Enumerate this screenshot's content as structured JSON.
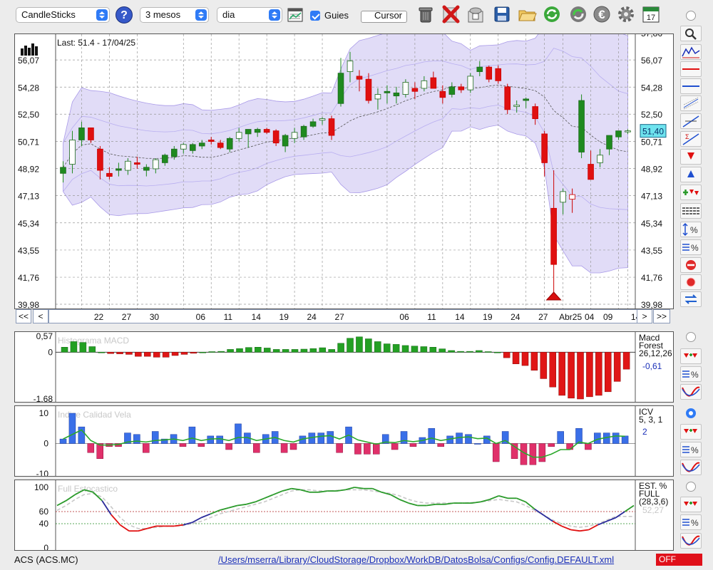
{
  "toolbar": {
    "chart_type": "CandleSticks",
    "period": "3 mesos",
    "interval": "dia",
    "guies_label": "Guies",
    "guies_checked": true,
    "cursor_label": "Cursor",
    "cursor_checked": false,
    "help_label": "?",
    "icons": [
      "calendar-grid-icon",
      "trash-icon",
      "delete-x-icon",
      "db-icon",
      "save-icon",
      "folder-icon",
      "refresh-icon",
      "sync-icon",
      "euro-icon",
      "gear-icon",
      "calendar-icon"
    ],
    "calendar_day": "17"
  },
  "main_chart": {
    "last_label": "Last: 51.4 - 17/04/25",
    "last_value_badge": "51,40",
    "y_ticks": [
      "56,07",
      "54,28",
      "52,50",
      "50,71",
      "48,92",
      "47,13",
      "45,34",
      "43,55",
      "41,76",
      "39,98"
    ],
    "y_top_partial": "57,86",
    "x_labels": [
      "22",
      "27",
      "30",
      "06",
      "11",
      "14",
      "19",
      "24",
      "27",
      "06",
      "11",
      "14",
      "19",
      "24",
      "27",
      "Abr25",
      "04",
      "09",
      "14",
      "17"
    ],
    "nav": {
      "first": "<<",
      "prev": "<",
      "next": ">",
      "last": ">>"
    }
  },
  "chart_data": [
    {
      "type": "candlestick",
      "title": "",
      "ylim": [
        39.98,
        57.86
      ],
      "candles": [
        {
          "o": 48.6,
          "h": 49.4,
          "l": 48.0,
          "c": 49.0
        },
        {
          "o": 49.2,
          "h": 51.4,
          "l": 48.6,
          "c": 50.8
        },
        {
          "o": 50.8,
          "h": 52.0,
          "l": 50.4,
          "c": 51.6
        },
        {
          "o": 51.6,
          "h": 51.6,
          "l": 50.6,
          "c": 50.8
        },
        {
          "o": 50.2,
          "h": 50.4,
          "l": 48.2,
          "c": 48.8
        },
        {
          "o": 48.6,
          "h": 49.0,
          "l": 48.2,
          "c": 48.4
        },
        {
          "o": 48.8,
          "h": 49.3,
          "l": 48.4,
          "c": 48.9
        },
        {
          "o": 48.8,
          "h": 49.6,
          "l": 48.5,
          "c": 49.4
        },
        {
          "o": 49.3,
          "h": 49.7,
          "l": 48.9,
          "c": 49.2
        },
        {
          "o": 48.8,
          "h": 49.2,
          "l": 48.4,
          "c": 49.0
        },
        {
          "o": 48.9,
          "h": 49.6,
          "l": 48.6,
          "c": 49.5
        },
        {
          "o": 49.3,
          "h": 49.9,
          "l": 49.1,
          "c": 49.8
        },
        {
          "o": 49.7,
          "h": 50.4,
          "l": 49.5,
          "c": 50.2
        },
        {
          "o": 50.2,
          "h": 50.6,
          "l": 49.9,
          "c": 50.5
        },
        {
          "o": 50.1,
          "h": 50.6,
          "l": 49.9,
          "c": 50.5
        },
        {
          "o": 50.4,
          "h": 50.8,
          "l": 50.2,
          "c": 50.6
        },
        {
          "o": 50.8,
          "h": 51.0,
          "l": 50.5,
          "c": 50.7
        },
        {
          "o": 50.6,
          "h": 50.8,
          "l": 50.2,
          "c": 50.3
        },
        {
          "o": 50.2,
          "h": 51.0,
          "l": 50.0,
          "c": 50.9
        },
        {
          "o": 50.9,
          "h": 51.6,
          "l": 50.7,
          "c": 51.3
        },
        {
          "o": 51.2,
          "h": 51.5,
          "l": 50.3,
          "c": 51.5
        },
        {
          "o": 51.3,
          "h": 51.6,
          "l": 51.0,
          "c": 51.5
        },
        {
          "o": 51.5,
          "h": 51.6,
          "l": 51.2,
          "c": 51.3
        },
        {
          "o": 51.4,
          "h": 51.5,
          "l": 50.4,
          "c": 50.6
        },
        {
          "o": 50.4,
          "h": 51.2,
          "l": 50.0,
          "c": 51.1
        },
        {
          "o": 50.9,
          "h": 51.6,
          "l": 50.6,
          "c": 51.3
        },
        {
          "o": 51.0,
          "h": 51.8,
          "l": 50.8,
          "c": 51.7
        },
        {
          "o": 51.7,
          "h": 52.2,
          "l": 51.6,
          "c": 52.0
        },
        {
          "o": 52.1,
          "h": 52.3,
          "l": 51.8,
          "c": 52.2
        },
        {
          "o": 52.2,
          "h": 52.4,
          "l": 50.8,
          "c": 51.1
        },
        {
          "o": 53.2,
          "h": 56.2,
          "l": 53.0,
          "c": 55.2
        },
        {
          "o": 55.3,
          "h": 56.6,
          "l": 54.6,
          "c": 56.0
        },
        {
          "o": 55.0,
          "h": 55.4,
          "l": 54.0,
          "c": 54.8
        },
        {
          "o": 54.8,
          "h": 55.2,
          "l": 53.2,
          "c": 53.4
        },
        {
          "o": 53.5,
          "h": 54.2,
          "l": 52.8,
          "c": 53.8
        },
        {
          "o": 53.9,
          "h": 54.4,
          "l": 53.2,
          "c": 54.0
        },
        {
          "o": 53.7,
          "h": 54.3,
          "l": 53.2,
          "c": 53.9
        },
        {
          "o": 53.8,
          "h": 54.8,
          "l": 53.6,
          "c": 54.6
        },
        {
          "o": 54.2,
          "h": 54.6,
          "l": 53.5,
          "c": 54.0
        },
        {
          "o": 54.2,
          "h": 55.0,
          "l": 54.0,
          "c": 54.7
        },
        {
          "o": 54.9,
          "h": 55.3,
          "l": 54.4,
          "c": 54.2
        },
        {
          "o": 54.0,
          "h": 54.4,
          "l": 53.2,
          "c": 53.6
        },
        {
          "o": 53.8,
          "h": 54.6,
          "l": 53.6,
          "c": 54.3
        },
        {
          "o": 54.3,
          "h": 54.5,
          "l": 53.9,
          "c": 54.1
        },
        {
          "o": 54.1,
          "h": 55.2,
          "l": 53.9,
          "c": 55.0
        },
        {
          "o": 55.3,
          "h": 56.0,
          "l": 55.0,
          "c": 55.6
        },
        {
          "o": 55.6,
          "h": 55.7,
          "l": 54.6,
          "c": 54.8
        },
        {
          "o": 55.5,
          "h": 55.7,
          "l": 54.5,
          "c": 54.7
        },
        {
          "o": 54.3,
          "h": 54.5,
          "l": 52.5,
          "c": 52.8
        },
        {
          "o": 53.0,
          "h": 53.4,
          "l": 52.6,
          "c": 53.1
        },
        {
          "o": 53.4,
          "h": 53.6,
          "l": 52.9,
          "c": 53.5
        },
        {
          "o": 53.0,
          "h": 53.2,
          "l": 51.8,
          "c": 52.2
        },
        {
          "o": 51.2,
          "h": 51.4,
          "l": 48.4,
          "c": 49.3
        },
        {
          "o": 46.3,
          "h": 48.8,
          "l": 40.7,
          "c": 42.6
        },
        {
          "o": 46.7,
          "h": 47.6,
          "l": 45.9,
          "c": 47.4
        },
        {
          "o": 47.2,
          "h": 47.6,
          "l": 46.0,
          "c": 46.9
        },
        {
          "o": 50.0,
          "h": 53.8,
          "l": 49.6,
          "c": 53.4
        },
        {
          "o": 49.2,
          "h": 50.1,
          "l": 48.4,
          "c": 48.2
        },
        {
          "o": 49.3,
          "h": 50.2,
          "l": 49.0,
          "c": 49.8
        },
        {
          "o": 50.2,
          "h": 51.0,
          "l": 49.8,
          "c": 51.1
        },
        {
          "o": 51.0,
          "h": 51.4,
          "l": 50.8,
          "c": 51.4
        },
        {
          "o": 51.4,
          "h": 51.5,
          "l": 51.2,
          "c": 51.4
        }
      ]
    },
    {
      "type": "bar",
      "title": "Histograma MACD",
      "ylim": [
        -1.68,
        0.57
      ],
      "y_ticks": [
        "0,57",
        "0",
        "-1,68"
      ],
      "side_label": "Macd\nForest\n26,12,26",
      "last_value": "-0,61",
      "values": [
        0.18,
        0.38,
        0.35,
        0.2,
        0,
        -0.05,
        -0.06,
        -0.08,
        -0.15,
        -0.15,
        -0.18,
        -0.18,
        -0.12,
        -0.08,
        -0.04,
        0,
        0.02,
        0.03,
        0.1,
        0.13,
        0.17,
        0.18,
        0.15,
        0.1,
        0.1,
        0.1,
        0.11,
        0.13,
        0.16,
        0.1,
        0.32,
        0.5,
        0.55,
        0.48,
        0.38,
        0.3,
        0.28,
        0.24,
        0.22,
        0.2,
        0.18,
        0.12,
        0.06,
        0.03,
        0.03,
        0.06,
        0.02,
        0,
        -0.2,
        -0.42,
        -0.48,
        -0.65,
        -0.95,
        -1.25,
        -1.55,
        -1.65,
        -1.68,
        -1.6,
        -1.55,
        -1.42,
        -1.05,
        -0.61
      ]
    },
    {
      "type": "bar",
      "title": "Indice Calidad Vela",
      "ylim": [
        -10,
        10
      ],
      "y_ticks": [
        "10",
        "0",
        "-10"
      ],
      "side_label": "ICV\n5, 3, 1",
      "last_value": "2",
      "values": [
        1.5,
        10,
        5.5,
        -3,
        -5,
        -1,
        -1,
        3.5,
        3,
        -3,
        4,
        1.5,
        3,
        -1,
        5.5,
        -1,
        2.5,
        2.5,
        -2,
        6.5,
        3.5,
        -3,
        3,
        4,
        -3,
        -2,
        2.5,
        3.5,
        3.5,
        4,
        -3,
        5.5,
        -3.5,
        -3.5,
        -3.5,
        3,
        -2,
        4,
        -1,
        2,
        5,
        -1,
        2.5,
        3.5,
        3,
        0,
        2.5,
        -6,
        4,
        -5,
        -7,
        -7,
        -6,
        -1,
        4,
        -2,
        5,
        -2,
        3.5,
        3.5,
        3.5,
        2.5
      ],
      "line": [
        1.5,
        3,
        4.5,
        1,
        -0.5,
        -0.5,
        -0.3,
        0.5,
        0.8,
        0.5,
        1,
        1.2,
        1.5,
        1,
        1.8,
        1,
        1.5,
        1.6,
        1,
        2,
        2,
        1,
        1.5,
        2,
        1,
        0.5,
        1.5,
        2,
        2.4,
        2.6,
        1.5,
        2.8,
        1.2,
        0.5,
        -0.2,
        0.5,
        0.3,
        1,
        0.6,
        1,
        1.8,
        1,
        1.5,
        2,
        2.2,
        1.6,
        1.8,
        0,
        1,
        -1,
        -3,
        -4.5,
        -4.5,
        -3.5,
        -2,
        -2,
        0.5,
        0,
        1.4,
        2,
        2.5,
        2.4
      ]
    },
    {
      "type": "line",
      "title": "Full Estocastico",
      "ylim": [
        0,
        100
      ],
      "y_ticks": [
        "100",
        "60",
        "40",
        "0"
      ],
      "side_label": "EST. %\nFULL\n(28,3,6)",
      "last_value": "52,27",
      "k": [
        70,
        78,
        88,
        96,
        92,
        78,
        55,
        38,
        28,
        28,
        32,
        36,
        36,
        36,
        38,
        42,
        50,
        56,
        62,
        66,
        70,
        72,
        76,
        82,
        88,
        94,
        98,
        96,
        92,
        92,
        94,
        94,
        96,
        100,
        98,
        98,
        92,
        88,
        80,
        74,
        70,
        70,
        72,
        72,
        74,
        74,
        74,
        76,
        80,
        86,
        82,
        82,
        76,
        64,
        54,
        44,
        36,
        30,
        28,
        30,
        38,
        44,
        50,
        60,
        70
      ],
      "d": [
        62,
        70,
        80,
        88,
        90,
        84,
        68,
        50,
        38,
        32,
        32,
        34,
        36,
        36,
        37,
        40,
        44,
        50,
        56,
        60,
        64,
        68,
        72,
        76,
        82,
        88,
        94,
        96,
        96,
        94,
        94,
        95,
        96,
        96,
        96,
        94,
        92,
        90,
        86,
        80,
        76,
        74,
        74,
        74,
        74,
        74,
        75,
        76,
        78,
        80,
        78,
        76,
        70,
        62,
        54,
        46,
        40,
        36,
        34,
        36,
        40,
        46,
        52,
        52,
        52
      ]
    }
  ],
  "status": {
    "ticker": "ACS (ACS.MC)",
    "path": "/Users/mserra/Library/CloudStorage/Dropbox/WorkDB/DatosBolsa/Configs/Config.DEFAULT.xml",
    "off_label": "OFF"
  },
  "side_tools": [
    "zoom-icon",
    "indicator-chart-icon",
    "horizontal-red-line-icon",
    "horizontal-blue-line-icon",
    "fibonacci-icon",
    "trendline-icon",
    "sigma-trendline-icon",
    "arrow-down-icon",
    "arrow-up-icon",
    "add-arrows-icon",
    "lines-icon",
    "percent-scale-icon",
    "percent-lines-icon",
    "stop-icon",
    "record-icon",
    "swap-icon"
  ]
}
